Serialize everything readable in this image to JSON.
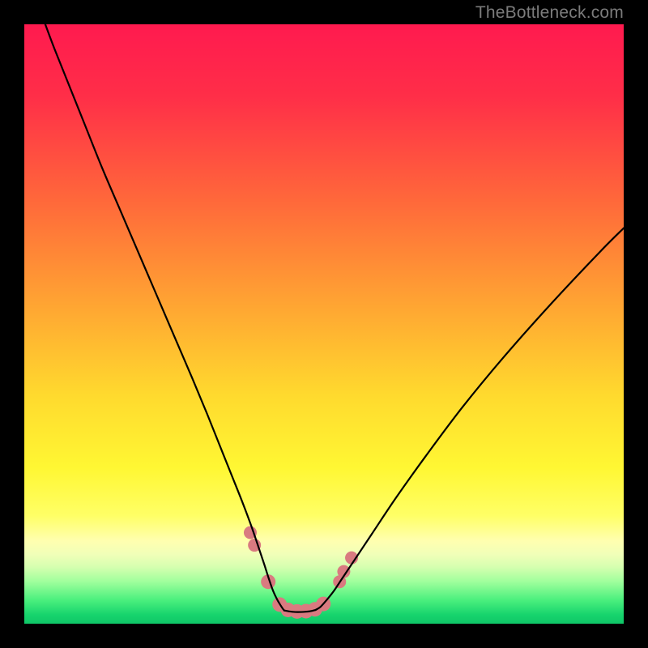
{
  "watermark": "TheBottleneck.com",
  "chart_data": {
    "type": "line",
    "title": "",
    "xlabel": "",
    "ylabel": "",
    "xlim": [
      0,
      100
    ],
    "ylim": [
      0,
      100
    ],
    "gradient_stops": [
      {
        "offset": 0.0,
        "color": "#ff1a4f"
      },
      {
        "offset": 0.12,
        "color": "#ff2e48"
      },
      {
        "offset": 0.3,
        "color": "#ff6a3a"
      },
      {
        "offset": 0.48,
        "color": "#ffa932"
      },
      {
        "offset": 0.62,
        "color": "#ffda2e"
      },
      {
        "offset": 0.74,
        "color": "#fff733"
      },
      {
        "offset": 0.82,
        "color": "#ffff66"
      },
      {
        "offset": 0.862,
        "color": "#ffffb0"
      },
      {
        "offset": 0.885,
        "color": "#f0ffb8"
      },
      {
        "offset": 0.905,
        "color": "#d6ffb0"
      },
      {
        "offset": 0.93,
        "color": "#9fff9c"
      },
      {
        "offset": 0.96,
        "color": "#4cf07e"
      },
      {
        "offset": 0.985,
        "color": "#17d46d"
      },
      {
        "offset": 1.0,
        "color": "#0fc667"
      }
    ],
    "series": [
      {
        "name": "left-curve",
        "x": [
          3.5,
          5,
          7,
          10,
          13,
          16,
          19,
          22,
          25,
          28,
          30.5,
          32.5,
          34.5,
          36.3,
          37.8,
          39.0,
          40.0,
          40.8,
          41.5,
          42.2,
          42.8,
          43.2,
          43.4
        ],
        "y": [
          100,
          96,
          91,
          83.5,
          76,
          69,
          62,
          55,
          48,
          41,
          35,
          30,
          25,
          20.5,
          16.5,
          13,
          10,
          7.5,
          5.5,
          4.0,
          3.0,
          2.4,
          2.2
        ]
      },
      {
        "name": "valley-floor",
        "x": [
          43.4,
          44.2,
          45.2,
          46.2,
          47.0,
          47.8,
          48.6
        ],
        "y": [
          2.2,
          2.05,
          1.95,
          1.95,
          2.0,
          2.1,
          2.3
        ]
      },
      {
        "name": "right-curve",
        "x": [
          48.6,
          49.4,
          50.4,
          51.6,
          53.0,
          55.0,
          58.0,
          62.0,
          67.0,
          73.0,
          80.0,
          88.0,
          96.0,
          100.0
        ],
        "y": [
          2.3,
          2.8,
          3.9,
          5.4,
          7.5,
          10.5,
          15.0,
          21.0,
          28.0,
          36.0,
          44.5,
          53.5,
          62.0,
          66.0
        ]
      }
    ],
    "markers": {
      "name": "valley-markers",
      "color": "#d97a80",
      "radius_large": 9,
      "radius_small": 8,
      "points": [
        {
          "x": 37.7,
          "y": 15.2,
          "r": "small"
        },
        {
          "x": 38.4,
          "y": 13.1,
          "r": "small"
        },
        {
          "x": 40.7,
          "y": 7.0,
          "r": "large"
        },
        {
          "x": 42.6,
          "y": 3.2,
          "r": "large"
        },
        {
          "x": 44.0,
          "y": 2.3,
          "r": "large"
        },
        {
          "x": 45.5,
          "y": 2.05,
          "r": "large"
        },
        {
          "x": 47.0,
          "y": 2.1,
          "r": "large"
        },
        {
          "x": 48.5,
          "y": 2.4,
          "r": "large"
        },
        {
          "x": 49.9,
          "y": 3.3,
          "r": "large"
        },
        {
          "x": 52.6,
          "y": 7.0,
          "r": "small"
        },
        {
          "x": 53.3,
          "y": 8.7,
          "r": "small"
        },
        {
          "x": 54.6,
          "y": 11.0,
          "r": "small"
        }
      ]
    }
  }
}
